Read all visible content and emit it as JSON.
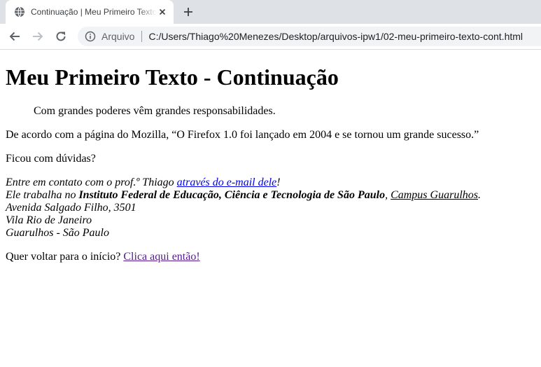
{
  "browser": {
    "tab_title": "Continuação | Meu Primeiro Texto",
    "omnibox_scheme": "Arquivo",
    "url": "C:/Users/Thiago%20Menezes/Desktop/arquivos-ipw1/02-meu-primeiro-texto-cont.html"
  },
  "page": {
    "heading": "Meu Primeiro Texto - Continuação",
    "quote_line": "Com grandes poderes vêm grandes responsabilidades.",
    "mozilla_text": "De acordo com a página do Mozilla, “O Firefox 1.0 foi lançado em 2004 e se tornou um grande sucesso.”",
    "question": "Ficou com dúvidas?",
    "address": {
      "contact_prefix": "Entre em contato com o prof.º Thiago ",
      "email_link": "através do e-mail dele",
      "contact_suffix": "!",
      "works_prefix": "Ele trabalha no ",
      "institute": "Instituto Federal de Educação, Ciência e Tecnologia de São Paulo",
      "comma": ", ",
      "campus_link": "Campus Guarulhos",
      "period": ".",
      "street": "Avenida Salgado Filho, 3501",
      "district": "Vila Rio de Janeiro",
      "city": "Guarulhos - São Paulo"
    },
    "back_prefix": "Quer voltar para o início? ",
    "back_link": "Clica aqui então!"
  },
  "icons": {
    "favicon": "globe-icon",
    "tab_close": "close-icon",
    "new_tab": "plus-icon",
    "back": "arrow-left-icon",
    "forward": "arrow-right-icon",
    "reload": "reload-icon",
    "site_info": "info-icon"
  },
  "colors": {
    "link": "#0000ee",
    "visited_link": "#551a8b",
    "tabstrip": "#dee1e6",
    "omnibox": "#f1f3f4"
  }
}
